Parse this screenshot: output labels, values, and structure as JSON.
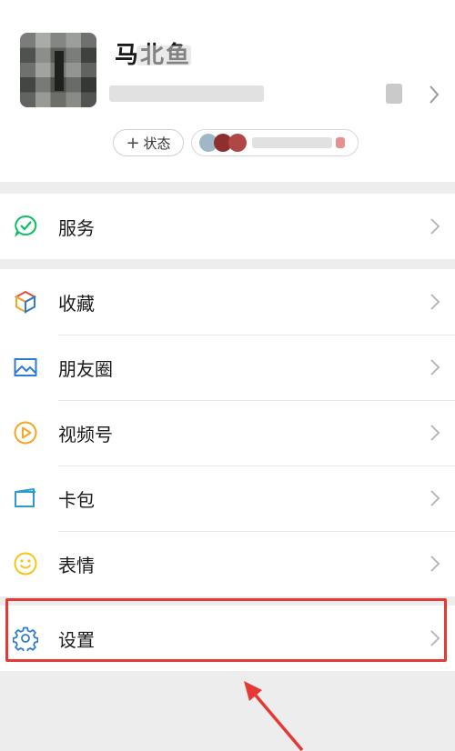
{
  "profile": {
    "nickname": "马北鱼",
    "status_button": {
      "plus": "+",
      "label": "状态"
    },
    "chevron_icon": "chevron-right-icon"
  },
  "menu": {
    "service": {
      "label": "服务",
      "icon": "wechat-pay-icon",
      "icon_color": "#07c160"
    },
    "favorites": {
      "label": "收藏",
      "icon": "cube-icon"
    },
    "moments": {
      "label": "朋友圈",
      "icon": "image-icon",
      "icon_color": "#2c7cd1"
    },
    "channels": {
      "label": "视频号",
      "icon": "play-circle-icon",
      "icon_color": "#f5a623"
    },
    "cards": {
      "label": "卡包",
      "icon": "wallet-icon",
      "icon_color": "#2c9ad1"
    },
    "stickers": {
      "label": "表情",
      "icon": "smiley-icon",
      "icon_color": "#f5c518"
    },
    "settings": {
      "label": "设置",
      "icon": "gear-icon",
      "icon_color": "#2c7cd1"
    }
  },
  "annotation": {
    "highlight_color": "#e53935"
  }
}
